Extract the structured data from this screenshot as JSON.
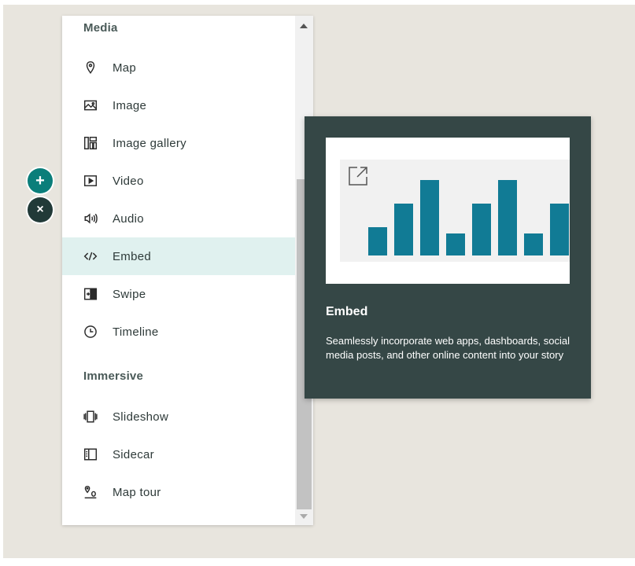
{
  "menu": {
    "sections": {
      "media": "Media",
      "immersive": "Immersive"
    },
    "items": [
      {
        "label": "Map",
        "icon": "map-pin-icon"
      },
      {
        "label": "Image",
        "icon": "image-icon"
      },
      {
        "label": "Image gallery",
        "icon": "image-gallery-icon"
      },
      {
        "label": "Video",
        "icon": "video-icon"
      },
      {
        "label": "Audio",
        "icon": "audio-icon"
      },
      {
        "label": "Embed",
        "icon": "code-icon",
        "active": true
      },
      {
        "label": "Swipe",
        "icon": "swipe-icon"
      },
      {
        "label": "Timeline",
        "icon": "clock-icon"
      },
      {
        "label": "Slideshow",
        "icon": "slideshow-icon"
      },
      {
        "label": "Sidecar",
        "icon": "sidecar-icon"
      },
      {
        "label": "Map tour",
        "icon": "map-tour-icon"
      }
    ]
  },
  "buttons": {
    "add": {
      "glyph": "+",
      "color": "#0b7e7a"
    },
    "close": {
      "glyph": "×",
      "color": "#213a38"
    }
  },
  "tooltip": {
    "title": "Embed",
    "description": "Seamlessly incorporate web apps, dashboards, social media posts, and other online content into your story",
    "preview_icon": "external-link-icon",
    "preview_bar_color": "#117b95"
  },
  "colors": {
    "accent": "#0b7e7a",
    "active_item_bg": "#e0f1ef",
    "tooltip_bg": "#354746",
    "canvas_bg": "#e8e5de"
  }
}
